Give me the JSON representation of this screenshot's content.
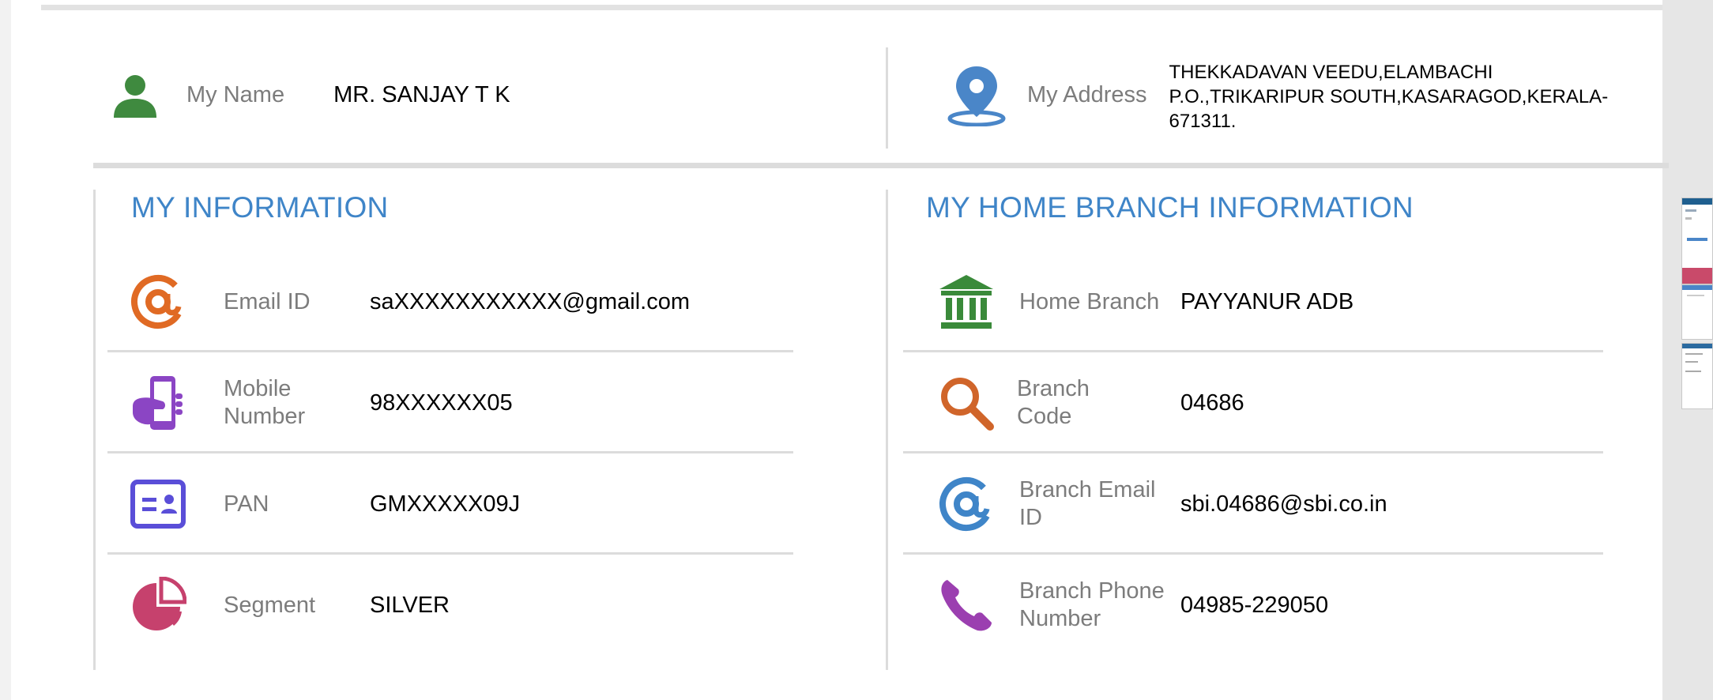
{
  "profile": {
    "name_label": "My Name",
    "name_value": "MR. SANJAY T K",
    "address_label": "My Address",
    "address_lines": [
      "THEKKADAVAN VEEDU,ELAMBACHI",
      "P.O.,TRIKARIPUR SOUTH,KASARAGOD,KERALA-",
      "671311."
    ]
  },
  "my_info": {
    "title": "MY INFORMATION",
    "rows": [
      {
        "icon": "at-sign-icon",
        "label": "Email ID",
        "value": "saXXXXXXXXXXX@gmail.com"
      },
      {
        "icon": "mobile-phone-icon",
        "label": "Mobile\nNumber",
        "value": "98XXXXXX05"
      },
      {
        "icon": "id-card-icon",
        "label": "PAN",
        "value": "GMXXXXX09J"
      },
      {
        "icon": "pie-chart-icon",
        "label": "Segment",
        "value": "SILVER"
      }
    ]
  },
  "branch_info": {
    "title": "MY HOME BRANCH INFORMATION",
    "rows": [
      {
        "icon": "bank-building-icon",
        "label": "Home Branch",
        "value": "PAYYANUR ADB"
      },
      {
        "icon": "search-icon",
        "label": "Branch\nCode",
        "value": "04686"
      },
      {
        "icon": "at-sign-icon",
        "label": "Branch Email\nID",
        "value": "sbi.04686@sbi.co.in"
      },
      {
        "icon": "phone-icon",
        "label": "Branch Phone\nNumber",
        "value": "04985-229050"
      }
    ]
  },
  "colors": {
    "title_blue": "#3f85c8",
    "person_green": "#3f8a3f",
    "location_blue": "#4a86c8",
    "at_orange": "#e06a24",
    "mobile_purple": "#8b45c4",
    "pan_indigo": "#5a4ed8",
    "segment_pink": "#c6416d",
    "bank_green": "#3a8a3a",
    "search_orange": "#d0652a",
    "at_blue": "#3f85c8",
    "phone_purple": "#9b3fb0"
  }
}
